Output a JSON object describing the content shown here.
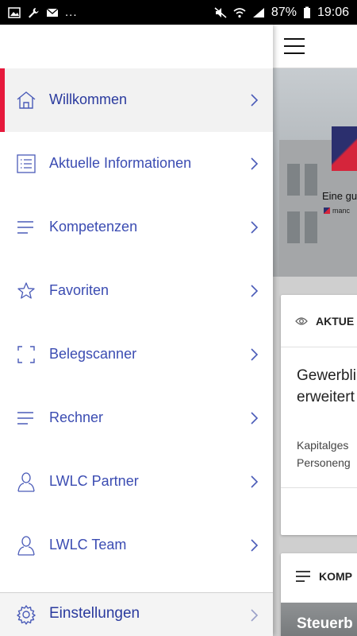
{
  "status_bar": {
    "dots": "...",
    "battery": "87%",
    "time": "19:06"
  },
  "drawer": {
    "items": [
      {
        "label": "Willkommen",
        "icon": "home-icon",
        "active": true
      },
      {
        "label": "Aktuelle Informationen",
        "icon": "list-icon",
        "active": false
      },
      {
        "label": "Kompetenzen",
        "icon": "lines-icon",
        "active": false
      },
      {
        "label": "Favoriten",
        "icon": "star-icon",
        "active": false
      },
      {
        "label": "Belegscanner",
        "icon": "scan-frame-icon",
        "active": false
      },
      {
        "label": "Rechner",
        "icon": "lines-icon",
        "active": false
      },
      {
        "label": "LWLC Partner",
        "icon": "person-icon",
        "active": false
      },
      {
        "label": "LWLC Team",
        "icon": "person-icon",
        "active": false
      }
    ],
    "settings": {
      "label": "Einstellungen",
      "icon": "gear-icon"
    }
  },
  "background": {
    "hero": {
      "tagline": "Eine gu",
      "brand": "manc"
    },
    "card1": {
      "header": "AKTUE",
      "title_line1": "Gewerbli",
      "title_line2": "erweitert",
      "text_line1": "Kapitalges",
      "text_line2": "Personeng"
    },
    "card2": {
      "header": "KOMP",
      "image_text": "Steuerb"
    }
  },
  "colors": {
    "accent": "#e6193c",
    "menu_text": "#3b4cb2",
    "icon_stroke": "#4a5bb8"
  }
}
